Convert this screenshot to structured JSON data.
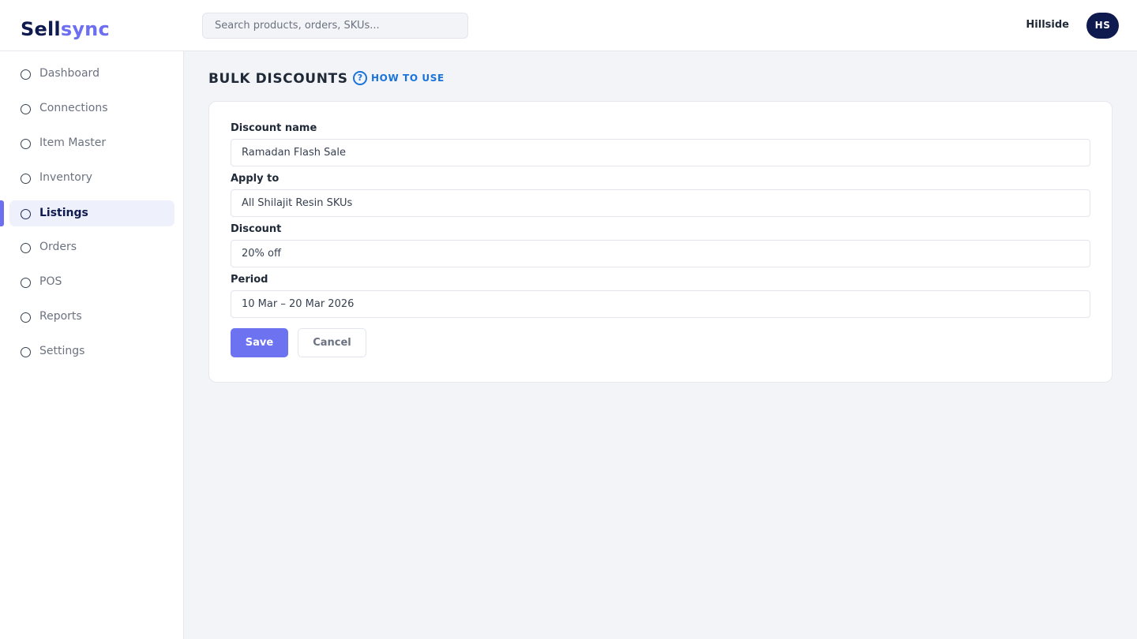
{
  "brand": {
    "part1": "Sell",
    "part2": "sync"
  },
  "search": {
    "placeholder": "Search products, orders, SKUs..."
  },
  "user": {
    "name": "Hillside",
    "initials": "HS"
  },
  "sidebar": {
    "items": [
      {
        "label": "Dashboard"
      },
      {
        "label": "Connections"
      },
      {
        "label": "Item Master"
      },
      {
        "label": "Inventory"
      },
      {
        "label": "Listings",
        "active": true
      },
      {
        "label": "Orders"
      },
      {
        "label": "POS"
      },
      {
        "label": "Reports"
      },
      {
        "label": "Settings"
      }
    ]
  },
  "page": {
    "title": "BULK DISCOUNTS",
    "help_label": "HOW TO USE",
    "help_icon": "question-circle-icon"
  },
  "form": {
    "discount_name": {
      "label": "Discount name",
      "value": "Ramadan Flash Sale"
    },
    "apply_to": {
      "label": "Apply to",
      "value": "All Shilajit Resin SKUs"
    },
    "discount": {
      "label": "Discount",
      "value": "20% off"
    },
    "period": {
      "label": "Period",
      "value": "10 Mar – 20 Mar 2026"
    },
    "save_label": "Save",
    "cancel_label": "Cancel"
  },
  "colors": {
    "brand_dark": "#0f1a4f",
    "accent": "#6d6ff0",
    "link": "#1a73d9"
  }
}
